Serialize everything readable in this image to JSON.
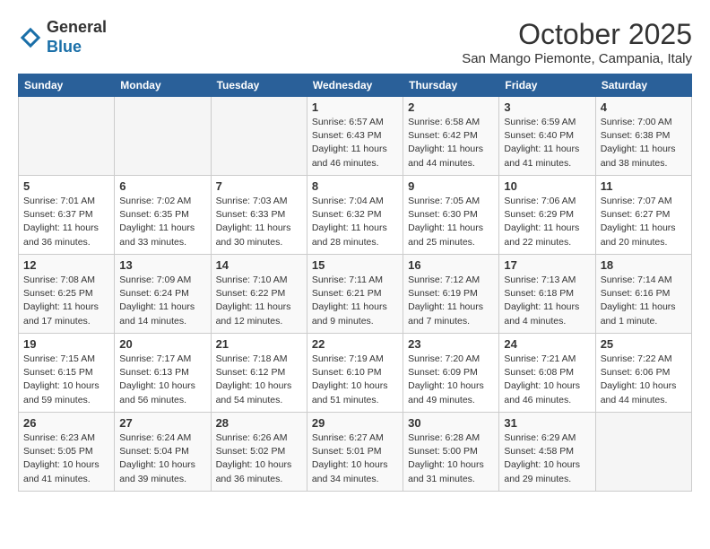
{
  "header": {
    "logo_general": "General",
    "logo_blue": "Blue",
    "month": "October 2025",
    "location": "San Mango Piemonte, Campania, Italy"
  },
  "days_of_week": [
    "Sunday",
    "Monday",
    "Tuesday",
    "Wednesday",
    "Thursday",
    "Friday",
    "Saturday"
  ],
  "weeks": [
    [
      {
        "day": "",
        "info": ""
      },
      {
        "day": "",
        "info": ""
      },
      {
        "day": "",
        "info": ""
      },
      {
        "day": "1",
        "info": "Sunrise: 6:57 AM\nSunset: 6:43 PM\nDaylight: 11 hours and 46 minutes."
      },
      {
        "day": "2",
        "info": "Sunrise: 6:58 AM\nSunset: 6:42 PM\nDaylight: 11 hours and 44 minutes."
      },
      {
        "day": "3",
        "info": "Sunrise: 6:59 AM\nSunset: 6:40 PM\nDaylight: 11 hours and 41 minutes."
      },
      {
        "day": "4",
        "info": "Sunrise: 7:00 AM\nSunset: 6:38 PM\nDaylight: 11 hours and 38 minutes."
      }
    ],
    [
      {
        "day": "5",
        "info": "Sunrise: 7:01 AM\nSunset: 6:37 PM\nDaylight: 11 hours and 36 minutes."
      },
      {
        "day": "6",
        "info": "Sunrise: 7:02 AM\nSunset: 6:35 PM\nDaylight: 11 hours and 33 minutes."
      },
      {
        "day": "7",
        "info": "Sunrise: 7:03 AM\nSunset: 6:33 PM\nDaylight: 11 hours and 30 minutes."
      },
      {
        "day": "8",
        "info": "Sunrise: 7:04 AM\nSunset: 6:32 PM\nDaylight: 11 hours and 28 minutes."
      },
      {
        "day": "9",
        "info": "Sunrise: 7:05 AM\nSunset: 6:30 PM\nDaylight: 11 hours and 25 minutes."
      },
      {
        "day": "10",
        "info": "Sunrise: 7:06 AM\nSunset: 6:29 PM\nDaylight: 11 hours and 22 minutes."
      },
      {
        "day": "11",
        "info": "Sunrise: 7:07 AM\nSunset: 6:27 PM\nDaylight: 11 hours and 20 minutes."
      }
    ],
    [
      {
        "day": "12",
        "info": "Sunrise: 7:08 AM\nSunset: 6:25 PM\nDaylight: 11 hours and 17 minutes."
      },
      {
        "day": "13",
        "info": "Sunrise: 7:09 AM\nSunset: 6:24 PM\nDaylight: 11 hours and 14 minutes."
      },
      {
        "day": "14",
        "info": "Sunrise: 7:10 AM\nSunset: 6:22 PM\nDaylight: 11 hours and 12 minutes."
      },
      {
        "day": "15",
        "info": "Sunrise: 7:11 AM\nSunset: 6:21 PM\nDaylight: 11 hours and 9 minutes."
      },
      {
        "day": "16",
        "info": "Sunrise: 7:12 AM\nSunset: 6:19 PM\nDaylight: 11 hours and 7 minutes."
      },
      {
        "day": "17",
        "info": "Sunrise: 7:13 AM\nSunset: 6:18 PM\nDaylight: 11 hours and 4 minutes."
      },
      {
        "day": "18",
        "info": "Sunrise: 7:14 AM\nSunset: 6:16 PM\nDaylight: 11 hours and 1 minute."
      }
    ],
    [
      {
        "day": "19",
        "info": "Sunrise: 7:15 AM\nSunset: 6:15 PM\nDaylight: 10 hours and 59 minutes."
      },
      {
        "day": "20",
        "info": "Sunrise: 7:17 AM\nSunset: 6:13 PM\nDaylight: 10 hours and 56 minutes."
      },
      {
        "day": "21",
        "info": "Sunrise: 7:18 AM\nSunset: 6:12 PM\nDaylight: 10 hours and 54 minutes."
      },
      {
        "day": "22",
        "info": "Sunrise: 7:19 AM\nSunset: 6:10 PM\nDaylight: 10 hours and 51 minutes."
      },
      {
        "day": "23",
        "info": "Sunrise: 7:20 AM\nSunset: 6:09 PM\nDaylight: 10 hours and 49 minutes."
      },
      {
        "day": "24",
        "info": "Sunrise: 7:21 AM\nSunset: 6:08 PM\nDaylight: 10 hours and 46 minutes."
      },
      {
        "day": "25",
        "info": "Sunrise: 7:22 AM\nSunset: 6:06 PM\nDaylight: 10 hours and 44 minutes."
      }
    ],
    [
      {
        "day": "26",
        "info": "Sunrise: 6:23 AM\nSunset: 5:05 PM\nDaylight: 10 hours and 41 minutes."
      },
      {
        "day": "27",
        "info": "Sunrise: 6:24 AM\nSunset: 5:04 PM\nDaylight: 10 hours and 39 minutes."
      },
      {
        "day": "28",
        "info": "Sunrise: 6:26 AM\nSunset: 5:02 PM\nDaylight: 10 hours and 36 minutes."
      },
      {
        "day": "29",
        "info": "Sunrise: 6:27 AM\nSunset: 5:01 PM\nDaylight: 10 hours and 34 minutes."
      },
      {
        "day": "30",
        "info": "Sunrise: 6:28 AM\nSunset: 5:00 PM\nDaylight: 10 hours and 31 minutes."
      },
      {
        "day": "31",
        "info": "Sunrise: 6:29 AM\nSunset: 4:58 PM\nDaylight: 10 hours and 29 minutes."
      },
      {
        "day": "",
        "info": ""
      }
    ]
  ]
}
